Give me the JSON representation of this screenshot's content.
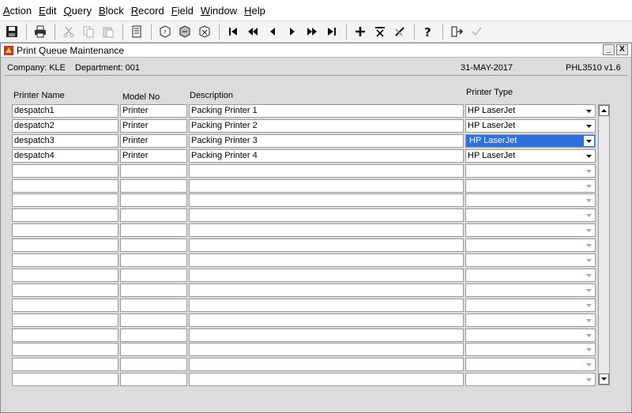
{
  "menu": [
    {
      "accel": "A",
      "rest": "ction"
    },
    {
      "accel": "E",
      "rest": "dit"
    },
    {
      "accel": "Q",
      "rest": "uery"
    },
    {
      "accel": "B",
      "rest": "lock"
    },
    {
      "accel": "R",
      "rest": "ecord"
    },
    {
      "accel": "F",
      "rest": "ield"
    },
    {
      "accel": "W",
      "rest": "indow"
    },
    {
      "accel": "H",
      "rest": "elp"
    }
  ],
  "window": {
    "title": "Print Queue Maintenance",
    "minimize_label": "_",
    "close_label": "X"
  },
  "info": {
    "company": "Company:  KLE",
    "department": "Department:  001",
    "date": "31-MAY-2017",
    "program": "PHL3510  v1.6"
  },
  "columns": {
    "printer_name": "Printer Name",
    "model_no": "Model No",
    "description": "Description",
    "printer_type": "Printer Type"
  },
  "rows": [
    {
      "printer_name": "despatch1",
      "model_no": "Printer",
      "description": "Packing Printer 1",
      "printer_type": "HP LaserJet"
    },
    {
      "printer_name": "despatch2",
      "model_no": "Printer",
      "description": "Packing Printer 2",
      "printer_type": "HP LaserJet"
    },
    {
      "printer_name": "despatch3",
      "model_no": "Printer",
      "description": "Packing Printer 3",
      "printer_type": "HP LaserJet"
    },
    {
      "printer_name": "despatch4",
      "model_no": "Printer",
      "description": "Packing Printer 4",
      "printer_type": "HP LaserJet"
    },
    {
      "printer_name": "",
      "model_no": "",
      "description": "",
      "printer_type": ""
    },
    {
      "printer_name": "",
      "model_no": "",
      "description": "",
      "printer_type": ""
    },
    {
      "printer_name": "",
      "model_no": "",
      "description": "",
      "printer_type": ""
    },
    {
      "printer_name": "",
      "model_no": "",
      "description": "",
      "printer_type": ""
    },
    {
      "printer_name": "",
      "model_no": "",
      "description": "",
      "printer_type": ""
    },
    {
      "printer_name": "",
      "model_no": "",
      "description": "",
      "printer_type": ""
    },
    {
      "printer_name": "",
      "model_no": "",
      "description": "",
      "printer_type": ""
    },
    {
      "printer_name": "",
      "model_no": "",
      "description": "",
      "printer_type": ""
    },
    {
      "printer_name": "",
      "model_no": "",
      "description": "",
      "printer_type": ""
    },
    {
      "printer_name": "",
      "model_no": "",
      "description": "",
      "printer_type": ""
    },
    {
      "printer_name": "",
      "model_no": "",
      "description": "",
      "printer_type": ""
    },
    {
      "printer_name": "",
      "model_no": "",
      "description": "",
      "printer_type": ""
    },
    {
      "printer_name": "",
      "model_no": "",
      "description": "",
      "printer_type": ""
    },
    {
      "printer_name": "",
      "model_no": "",
      "description": "",
      "printer_type": ""
    },
    {
      "printer_name": "",
      "model_no": "",
      "description": "",
      "printer_type": ""
    }
  ],
  "selected_row": 2,
  "colors": {
    "selection": "#2f6fdf",
    "window_bg": "#dcdcdc",
    "field_bg": "#ffffff"
  }
}
